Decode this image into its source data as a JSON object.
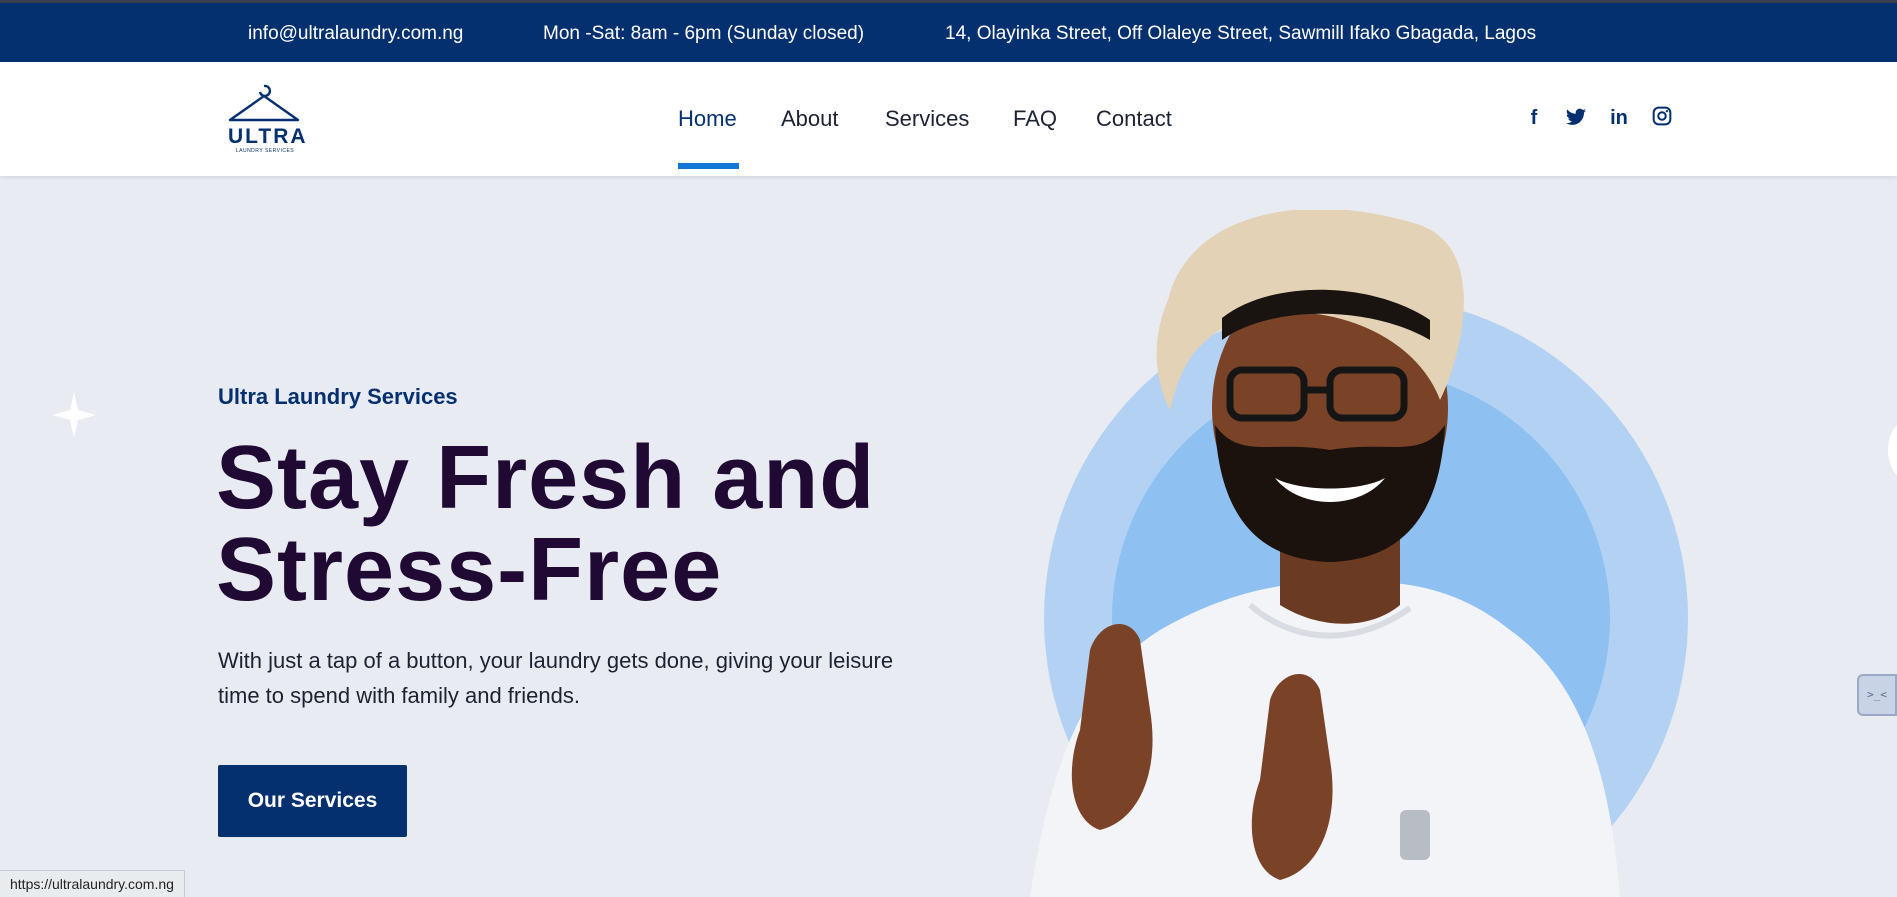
{
  "topbar": {
    "email": "info@ultralaundry.com.ng",
    "hours": "Mon -Sat: 8am - 6pm (Sunday closed)",
    "address": "14, Olayinka Street, Off Olaleye Street, Sawmill Ifako Gbagada, Lagos"
  },
  "logo": {
    "name": "ULTRA",
    "tagline": "LAUNDRY SERVICES"
  },
  "nav": {
    "items": [
      {
        "label": "Home",
        "active": true
      },
      {
        "label": "About"
      },
      {
        "label": "Services"
      },
      {
        "label": "FAQ"
      },
      {
        "label": "Contact"
      }
    ]
  },
  "social": {
    "icons": [
      "facebook-icon",
      "twitter-icon",
      "linkedin-icon",
      "instagram-icon"
    ],
    "labels": {
      "facebook": "f",
      "linkedin": "in"
    }
  },
  "hero": {
    "subtitle": "Ultra Laundry Services",
    "title_line1": "Stay Fresh and",
    "title_line2": "Stress-Free",
    "description": "With just a tap of a button, your laundry gets done, giving your leisure time to spend with family and friends.",
    "button_label": "Our Services"
  },
  "side_widget": {
    "label": ">_<"
  },
  "status_bar": {
    "url": "https://ultralaundry.com.ng"
  },
  "colors": {
    "brand_navy": "#05306f",
    "accent_blue": "#1476d6",
    "title_dark": "#200a33",
    "page_bg": "#e8ecf2",
    "circle_outer": "#b3d2f3",
    "circle_inner": "#8ec0f2"
  }
}
